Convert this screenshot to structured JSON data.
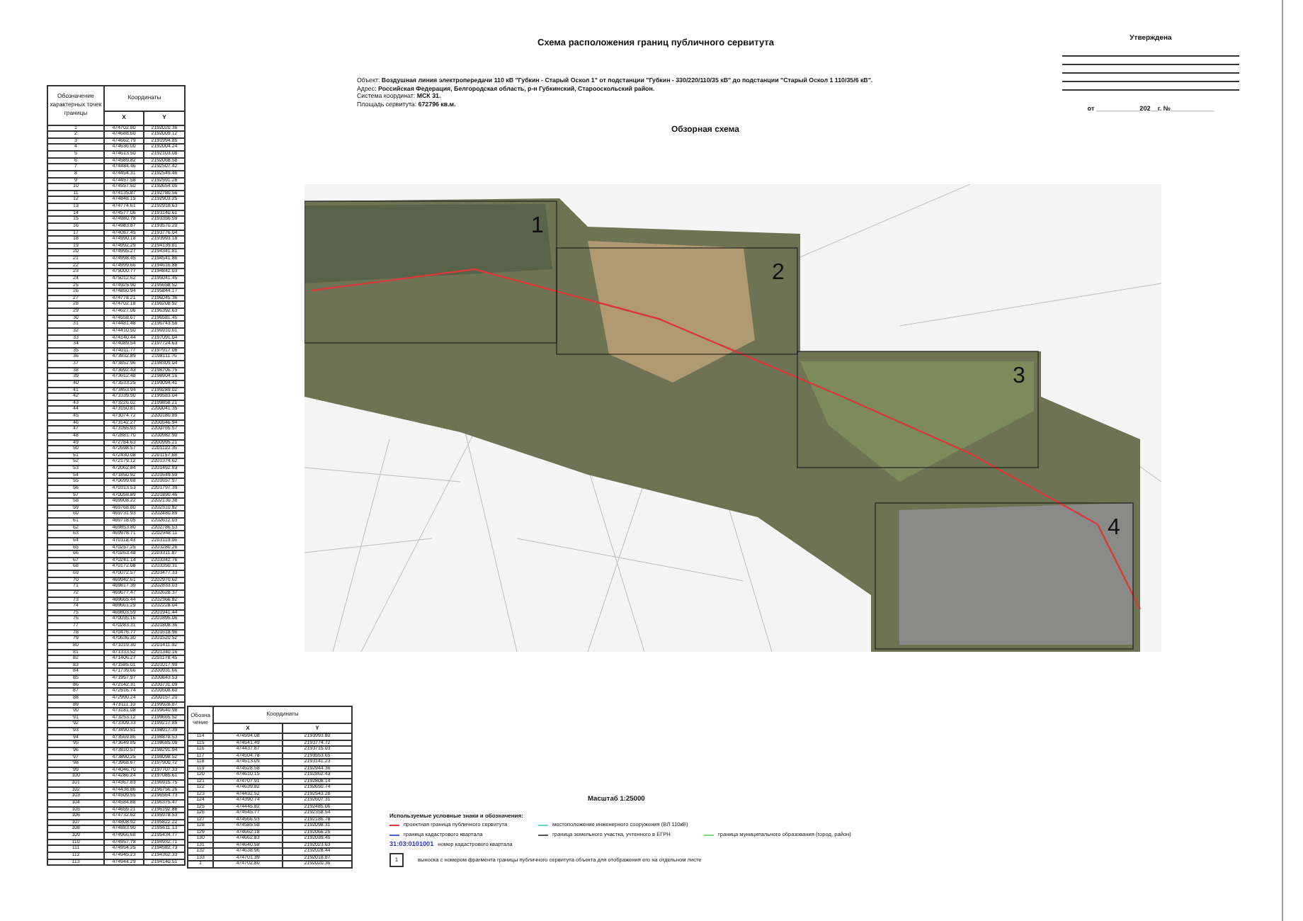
{
  "title": "Схема расположения границ публичного сервитута",
  "approval": {
    "heading": "Утверждена",
    "date_line": "от ____________202__г. №____________"
  },
  "object_info": [
    "Объект: **Воздушная линия электропередачи 110 кВ \"Губкин - Старый Оскол 1\" от подстанции \"Губкин - 330/220/110/35 кВ\" до подстанции \"Старый Оскол 1 110/35/6 кВ\".**",
    "Адрес: **Российская Федерация, Белгородская область, р-н Губкинский, Старооскольский район.**",
    "Система координат: **МСК 31.**",
    "Площадь сервитута: **672796 кв.м.**"
  ],
  "overview_title": "Обзорная схема",
  "points_table": {
    "coords_header": "Координаты",
    "columns": [
      "Обозначение характерных точек границы",
      "X",
      "Y"
    ],
    "rows": [
      [
        "1",
        "474702.80",
        "2192020.36"
      ],
      [
        "2",
        "474688.60",
        "2192009.12"
      ],
      [
        "3",
        "474662.79",
        "2191994.85"
      ],
      [
        "4",
        "474636.00",
        "2192004.24"
      ],
      [
        "5",
        "474613.50",
        "2192103.08"
      ],
      [
        "6",
        "474589.82",
        "2192068.58"
      ],
      [
        "7",
        "474484.46",
        "2192507.42"
      ],
      [
        "8",
        "474454.31",
        "2192549.46"
      ],
      [
        "9",
        "474457.58",
        "2192591.28"
      ],
      [
        "10",
        "474557.50",
        "2192654.05"
      ],
      [
        "11",
        "474135.87",
        "2192780.56"
      ],
      [
        "12",
        "474848.15",
        "2192903.25"
      ],
      [
        "13",
        "474774.61",
        "2192918.63"
      ],
      [
        "14",
        "474577.06",
        "2193140.61"
      ],
      [
        "15",
        "474980.78",
        "2193356.59"
      ],
      [
        "16",
        "474983.87",
        "2193570.20"
      ],
      [
        "17",
        "474087.45",
        "2193776.04"
      ],
      [
        "18",
        "474990.18",
        "2193993.18"
      ],
      [
        "19",
        "474992.29",
        "2194139.81"
      ],
      [
        "20",
        "474995.27",
        "2194341.81"
      ],
      [
        "21",
        "474998.45",
        "2194541.86"
      ],
      [
        "22",
        "474999.66",
        "2194616.88"
      ],
      [
        "23",
        "475000.77",
        "2194842.03"
      ],
      [
        "24",
        "475012.62",
        "2195041.45"
      ],
      [
        "25",
        "474925.90",
        "2195658.52"
      ],
      [
        "26",
        "474850.94",
        "2195844.17"
      ],
      [
        "27",
        "474778.21",
        "2196045.36"
      ],
      [
        "28",
        "474702.18",
        "2196208.92"
      ],
      [
        "29",
        "474627.06",
        "2196392.63"
      ],
      [
        "30",
        "474558.67",
        "2196581.45"
      ],
      [
        "31",
        "474481.48",
        "2196743.58"
      ],
      [
        "32",
        "474410.50",
        "2196910.61"
      ],
      [
        "33",
        "474140.44",
        "2197091.04"
      ],
      [
        "34",
        "474089.54",
        "2197724.63"
      ],
      [
        "35",
        "474011.77",
        "2197917.08"
      ],
      [
        "36",
        "473932.89",
        "2198111.76"
      ],
      [
        "37",
        "473852.96",
        "2198309.04"
      ],
      [
        "38",
        "473692.43",
        "2198706.75"
      ],
      [
        "39",
        "473612.48",
        "2198904.16"
      ],
      [
        "40",
        "473533.25",
        "2199094.41"
      ],
      [
        "41",
        "473453.94",
        "2199289.02"
      ],
      [
        "42",
        "473339.90",
        "2199583.04"
      ],
      [
        "43",
        "473226.02",
        "2199858.21"
      ],
      [
        "44",
        "473150.81",
        "2200041.35"
      ],
      [
        "45",
        "473074.72",
        "2200180.89"
      ],
      [
        "46",
        "473142.27",
        "2200546.94"
      ],
      [
        "47",
        "473165.93",
        "2200765.57"
      ],
      [
        "48",
        "472881.70",
        "2200982.90"
      ],
      [
        "49",
        "472784.63",
        "2200995.21"
      ],
      [
        "50",
        "472698.57",
        "2201110.35"
      ],
      [
        "51",
        "472430.08",
        "2201157.68"
      ],
      [
        "52",
        "472179.12",
        "2201374.62"
      ],
      [
        "53",
        "472062.84",
        "2201492.83"
      ],
      [
        "54",
        "471850.92",
        "2201649.59"
      ],
      [
        "55",
        "470699.68",
        "2201657.97"
      ],
      [
        "56",
        "470313.53",
        "2201797.39"
      ],
      [
        "57",
        "470058.89",
        "2201890.46"
      ],
      [
        "58",
        "469908.22",
        "2202130.38"
      ],
      [
        "59",
        "469768.80",
        "2202310.82"
      ],
      [
        "60",
        "469731.93",
        "2202480.89"
      ],
      [
        "61",
        "469718.05",
        "2202612.03"
      ],
      [
        "62",
        "469853.80",
        "2202786.53"
      ],
      [
        "63",
        "469978.71",
        "2202948.11"
      ],
      [
        "64",
        "470118.43",
        "2203119.06"
      ],
      [
        "65",
        "470257.25",
        "2203280.26"
      ],
      [
        "66",
        "470263.48",
        "2203311.87"
      ],
      [
        "67",
        "470241.14",
        "2203342.76"
      ],
      [
        "68",
        "470172.08",
        "2203350.31"
      ],
      [
        "69",
        "470072.57",
        "2203477.33"
      ],
      [
        "70",
        "469942.61",
        "2202970.62"
      ],
      [
        "71",
        "469817.39",
        "2202833.03"
      ],
      [
        "72",
        "469677.47",
        "2202628.37"
      ],
      [
        "73",
        "469665.44",
        "2202366.82"
      ],
      [
        "74",
        "469661.29",
        "2202228.04"
      ],
      [
        "75",
        "469803.59",
        "2201941.44"
      ],
      [
        "76",
        "470035.16",
        "2201895.06"
      ],
      [
        "77",
        "470283.31",
        "2201808.36"
      ],
      [
        "78",
        "470476.77",
        "2201618.96"
      ],
      [
        "79",
        "470636.30",
        "2201520.52"
      ],
      [
        "80",
        "471019.30",
        "2201411.92"
      ],
      [
        "81",
        "471333.52",
        "2201340.16"
      ],
      [
        "82",
        "471406.27",
        "2201178.45"
      ],
      [
        "83",
        "471585.01",
        "2201017.99"
      ],
      [
        "84",
        "471739.66",
        "2200931.66"
      ],
      [
        "85",
        "471957.97",
        "2200843.53"
      ],
      [
        "86",
        "472142.31",
        "2200731.09"
      ],
      [
        "87",
        "472516.74",
        "2200508.60"
      ],
      [
        "88",
        "472990.24",
        "2200157.20"
      ],
      [
        "89",
        "473111.10",
        "2199928.87"
      ],
      [
        "90",
        "473181.08",
        "2199640.98"
      ],
      [
        "91",
        "473253.12",
        "2199665.52"
      ],
      [
        "92",
        "473309.33",
        "2199217.85"
      ],
      [
        "93",
        "473490.51",
        "2198917.39"
      ],
      [
        "94",
        "473569.86",
        "2198878.53"
      ],
      [
        "95",
        "473649.85",
        "2198685.08"
      ],
      [
        "96",
        "473810.57",
        "2198291.94"
      ],
      [
        "97",
        "473890.25",
        "2198098.52"
      ],
      [
        "98",
        "473968.67",
        "2197900.72"
      ],
      [
        "99",
        "474046.70",
        "2197707.33"
      ],
      [
        "100",
        "474286.24",
        "2197085.61"
      ],
      [
        "101",
        "474367.83",
        "2196915.75"
      ],
      [
        "102",
        "474438.86",
        "2196756.26"
      ],
      [
        "103",
        "474509.55",
        "2196564.73"
      ],
      [
        "104",
        "474584.88",
        "2196375.47"
      ],
      [
        "105",
        "474659.21",
        "2196192.88"
      ],
      [
        "106",
        "474732.62",
        "2195978.53"
      ],
      [
        "107",
        "474808.92",
        "2195822.22"
      ],
      [
        "108",
        "474883.90",
        "2195611.13"
      ],
      [
        "109",
        "474966.68",
        "2195434.77"
      ],
      [
        "110",
        "474957.78",
        "2194932.71"
      ],
      [
        "111",
        "474954.25",
        "2194582.73"
      ],
      [
        "112",
        "474945.23",
        "2194362.33"
      ],
      [
        "113",
        "474944.29",
        "2194140.51"
      ]
    ]
  },
  "points_table_2": {
    "coords_header": "Координаты",
    "columns": [
      "Обозначение",
      "X",
      "Y"
    ],
    "rows": [
      [
        "114",
        "474594.08",
        "2193993.80"
      ],
      [
        "115",
        "474541.49",
        "2193774.72"
      ],
      [
        "116",
        "474437.87",
        "2193715.03"
      ],
      [
        "117",
        "474504.78",
        "2193553.65"
      ],
      [
        "118",
        "474513.09",
        "2193141.23"
      ],
      [
        "119",
        "474528.58",
        "2192944.36"
      ],
      [
        "120",
        "474610.15",
        "2192862.43"
      ],
      [
        "121",
        "474707.91",
        "2192808.14"
      ],
      [
        "122",
        "474639.82",
        "2192650.74"
      ],
      [
        "123",
        "474432.52",
        "2192543.28"
      ],
      [
        "124",
        "474390.74",
        "2192607.31"
      ],
      [
        "125",
        "474445.82",
        "2192485.06"
      ],
      [
        "126",
        "474545.77",
        "2192358.54"
      ],
      [
        "127",
        "474566.93",
        "2192186.78"
      ],
      [
        "128",
        "474585.58",
        "2192098.31"
      ],
      [
        "129",
        "474662.18",
        "2192066.25"
      ],
      [
        "130",
        "474662.83",
        "2192039.45"
      ],
      [
        "131",
        "474640.58",
        "2192023.63"
      ],
      [
        "132",
        "474638.96",
        "2192028.44"
      ],
      [
        "133",
        "474701.39",
        "2192018.87"
      ],
      [
        "1",
        "474702.80",
        "2192020.36"
      ]
    ]
  },
  "map": {
    "fragments": [
      {
        "label": "1"
      },
      {
        "label": "2"
      },
      {
        "label": "3"
      },
      {
        "label": "4"
      }
    ]
  },
  "scale": "Масштаб 1:25000",
  "legend": {
    "title": "Используемые условные знаки и обозначения:",
    "items": [
      {
        "color": "#d83a3a",
        "text": "проектная граница публичного сервитута"
      },
      {
        "color": "#5fd8d0",
        "text": "местоположение инженерного сооружения (ВЛ 110кВ)"
      },
      {
        "color": "#4a5fd8",
        "text": "граница кадастрового квартала"
      },
      {
        "color": "#555555",
        "text": "граница земельного участка, учтенного в ЕГРН"
      },
      {
        "color": "#7ed87e",
        "text": "граница муниципального образования (город, район)"
      }
    ],
    "cadastral_number": {
      "code": "31:03:0101001",
      "text": "номер кадастрового квартала"
    },
    "callout": {
      "label": "1",
      "text": "выноска с номером фрагмента границы публичного сервитута объекта для отображения его на отдельном листе"
    }
  }
}
